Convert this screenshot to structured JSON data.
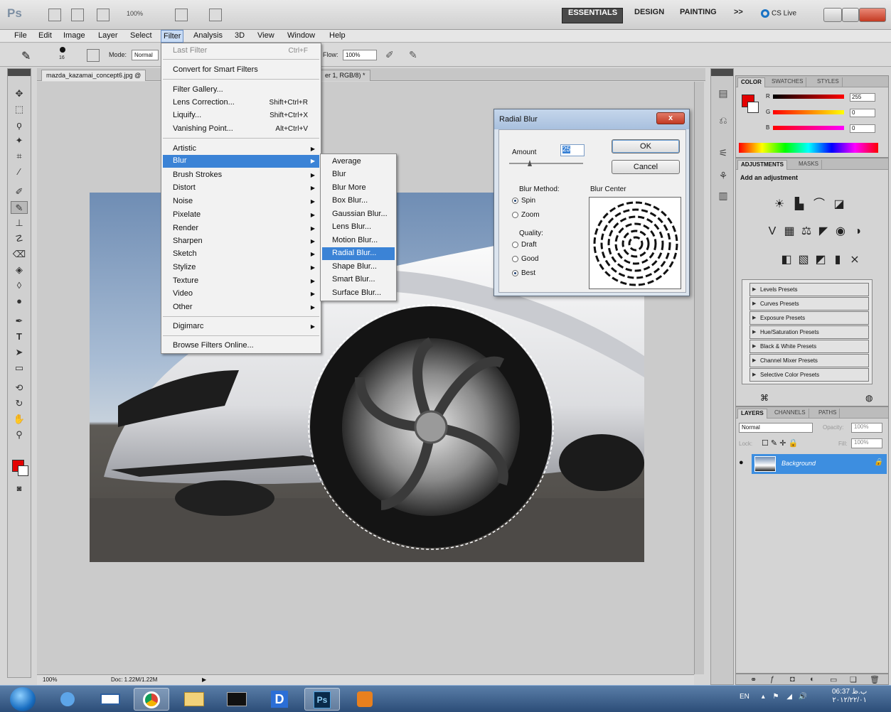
{
  "app": {
    "logo": "Ps",
    "zoom_value": "100%",
    "workspaces": [
      "ESSENTIALS",
      "DESIGN",
      "PAINTING",
      ">>"
    ],
    "cs_live": "CS Live"
  },
  "menubar": [
    "File",
    "Edit",
    "Image",
    "Layer",
    "Select",
    "Filter",
    "Analysis",
    "3D",
    "View",
    "Window",
    "Help"
  ],
  "options_bar": {
    "mode_label": "Mode:",
    "mode_value": "Normal",
    "brush_size": "16",
    "flow_label": "Flow:",
    "flow_value": "100%"
  },
  "document": {
    "tab1": "mazda_kazamai_concept6.jpg @",
    "tab2": "er 1, RGB/8) *",
    "status_zoom": "100%",
    "status_doc": "Doc: 1.22M/1.22M"
  },
  "filter_menu": {
    "last_filter": "Last Filter",
    "last_filter_sc": "Ctrl+F",
    "convert": "Convert for Smart Filters",
    "gallery": "Filter Gallery...",
    "lens": "Lens Correction...",
    "lens_sc": "Shift+Ctrl+R",
    "liquify": "Liquify...",
    "liquify_sc": "Shift+Ctrl+X",
    "vanishing": "Vanishing Point...",
    "vanishing_sc": "Alt+Ctrl+V",
    "groups": [
      "Artistic",
      "Blur",
      "Brush Strokes",
      "Distort",
      "Noise",
      "Pixelate",
      "Render",
      "Sharpen",
      "Sketch",
      "Stylize",
      "Texture",
      "Video",
      "Other"
    ],
    "digimarc": "Digimarc",
    "browse": "Browse Filters Online..."
  },
  "blur_submenu": [
    "Average",
    "Blur",
    "Blur More",
    "Box Blur...",
    "Gaussian Blur...",
    "Lens Blur...",
    "Motion Blur...",
    "Radial Blur...",
    "Shape Blur...",
    "Smart Blur...",
    "Surface Blur..."
  ],
  "dialog": {
    "title": "Radial Blur",
    "close": "x",
    "amount_label": "Amount",
    "amount_value": "25",
    "ok": "OK",
    "cancel": "Cancel",
    "method_label": "Blur Method:",
    "spin": "Spin",
    "zoom": "Zoom",
    "quality_label": "Quality:",
    "draft": "Draft",
    "good": "Good",
    "best": "Best",
    "center_label": "Blur Center"
  },
  "color_panel": {
    "tabs": [
      "COLOR",
      "SWATCHES",
      "STYLES"
    ],
    "r_label": "R",
    "g_label": "G",
    "b_label": "B",
    "r_value": "255",
    "g_value": "0",
    "b_value": "0"
  },
  "adjust_panel": {
    "tabs": [
      "ADJUSTMENTS",
      "MASKS"
    ],
    "heading": "Add an adjustment",
    "presets": [
      "Levels Presets",
      "Curves Presets",
      "Exposure Presets",
      "Hue/Saturation Presets",
      "Black & White Presets",
      "Channel Mixer Presets",
      "Selective Color Presets"
    ]
  },
  "layers_panel": {
    "tabs": [
      "LAYERS",
      "CHANNELS",
      "PATHS"
    ],
    "blend": "Normal",
    "opacity_label": "Opacity:",
    "opacity_value": "100%",
    "fill_label": "Fill:",
    "fill_value": "100%",
    "lock_label": "Lock:",
    "layer_name": "Background"
  },
  "taskbar": {
    "lang": "EN",
    "time": "06:37 ب.ظ",
    "date": "۲۰۱۲/۲۲/۰۱"
  },
  "colors": {
    "foreground": "#e30000",
    "highlight": "#3b83d6"
  }
}
